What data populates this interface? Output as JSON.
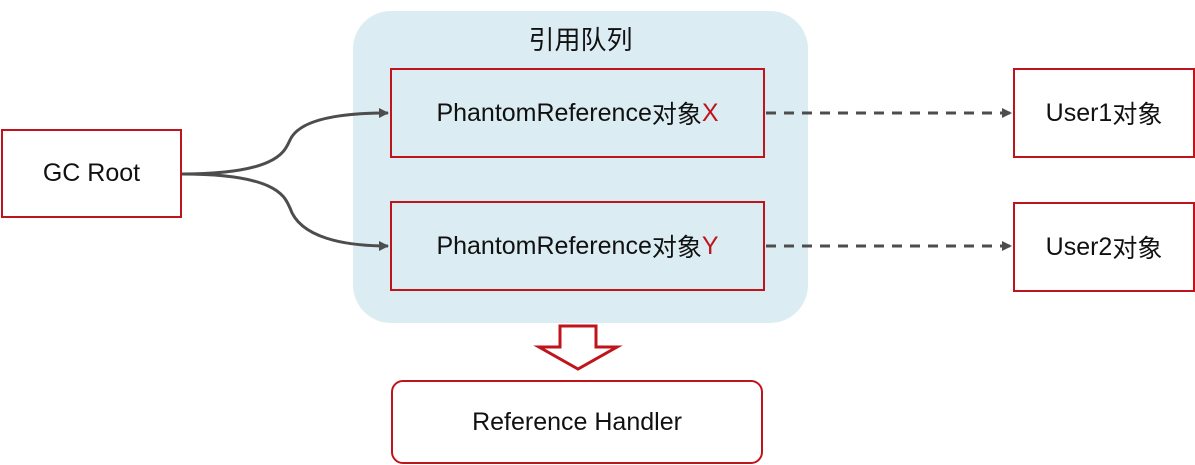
{
  "gc_root": {
    "label": "GC Root"
  },
  "queue": {
    "title": "引用队列",
    "refs": [
      {
        "name": "PhantomReference",
        "suffix": "对象",
        "letter": "X"
      },
      {
        "name": "PhantomReference",
        "suffix": "对象",
        "letter": "Y"
      }
    ]
  },
  "users": [
    {
      "label": "User1",
      "suffix": "对象"
    },
    {
      "label": "User2",
      "suffix": "对象"
    }
  ],
  "handler": {
    "label": "Reference Handler"
  },
  "colors": {
    "border": "#c0141c",
    "accent": "#c0141c",
    "queue_fill": "#dbedf3",
    "arrow": "#4d4d4d"
  }
}
